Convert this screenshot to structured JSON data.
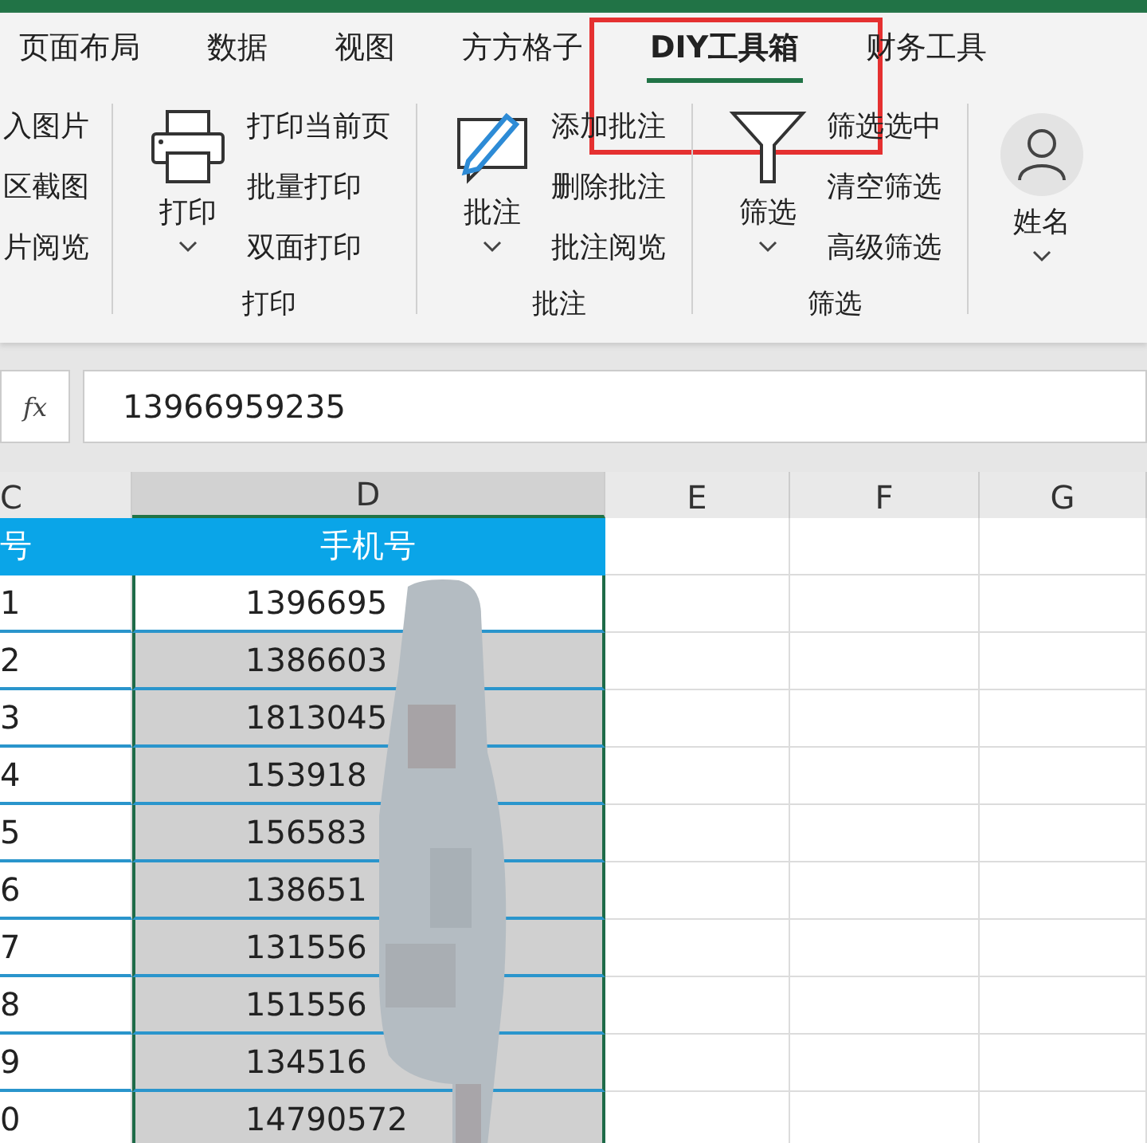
{
  "tabs": [
    {
      "label": "页面布局",
      "selected": false,
      "highlighted": false
    },
    {
      "label": "数据",
      "selected": false,
      "highlighted": false
    },
    {
      "label": "视图",
      "selected": false,
      "highlighted": false
    },
    {
      "label": "方方格子",
      "selected": false,
      "highlighted": false
    },
    {
      "label": "DIY工具箱",
      "selected": true,
      "highlighted": true
    },
    {
      "label": "财务工具",
      "selected": false,
      "highlighted": false
    }
  ],
  "ribbon": {
    "partial_items": [
      "入图片",
      "区截图",
      "片阅览"
    ],
    "groups": [
      {
        "kind": "print",
        "button": "打印",
        "items": [
          "打印当前页",
          "批量打印",
          "双面打印"
        ],
        "label": "打印"
      },
      {
        "kind": "comment",
        "button": "批注",
        "items": [
          "添加批注",
          "删除批注",
          "批注阅览"
        ],
        "label": "批注"
      },
      {
        "kind": "filter",
        "button": "筛选",
        "items": [
          "筛选选中",
          "清空筛选",
          "高级筛选"
        ],
        "label": "筛选"
      }
    ],
    "user": {
      "label": "姓名"
    }
  },
  "formula_bar": {
    "fx_label": "fx",
    "value": "13966959235"
  },
  "columns": [
    {
      "label": "C",
      "selected": false
    },
    {
      "label": "D",
      "selected": true
    },
    {
      "label": "E",
      "selected": false
    },
    {
      "label": "F",
      "selected": false
    },
    {
      "label": "G",
      "selected": false
    }
  ],
  "header_row": [
    "号",
    "手机号"
  ],
  "redacted": true,
  "rows": [
    {
      "number": "1",
      "phone": "1396695",
      "selected": false
    },
    {
      "number": "2",
      "phone": "1386603",
      "selected": true
    },
    {
      "number": "3",
      "phone": "1813045",
      "selected": true
    },
    {
      "number": "4",
      "phone": "153918",
      "selected": true
    },
    {
      "number": "5",
      "phone": "156583",
      "selected": true
    },
    {
      "number": "6",
      "phone": "138651",
      "selected": true
    },
    {
      "number": "7",
      "phone": "131556",
      "selected": true
    },
    {
      "number": "8",
      "phone": "151556",
      "selected": true
    },
    {
      "number": "9",
      "phone": "134516",
      "selected": true
    },
    {
      "number": "0",
      "phone": "14790572",
      "selected": true
    }
  ]
}
